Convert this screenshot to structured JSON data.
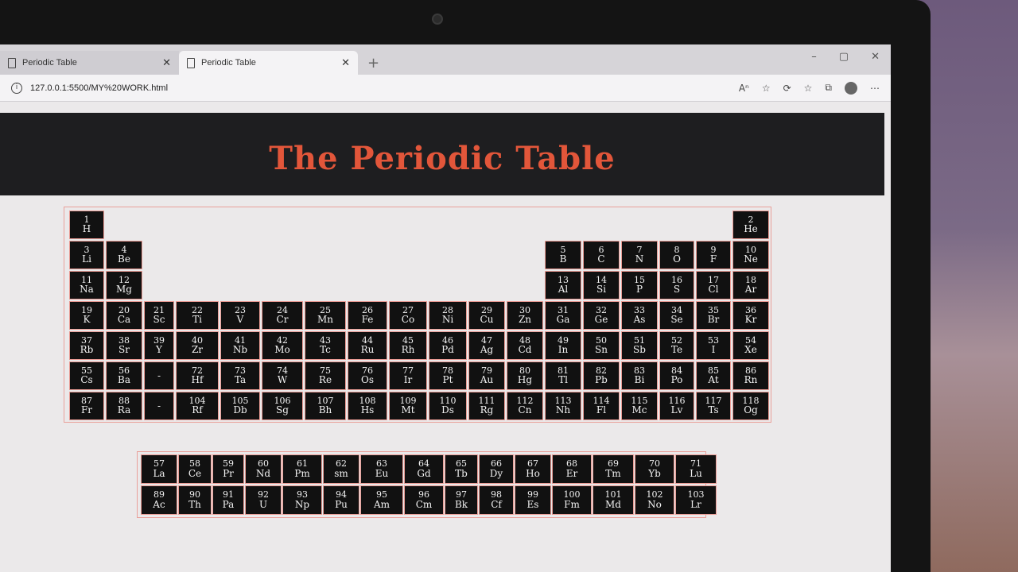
{
  "browser": {
    "tabs": [
      {
        "title": "Periodic Table",
        "active": false
      },
      {
        "title": "Periodic Table",
        "active": true
      }
    ],
    "url": "127.0.0.1:5500/MY%20WORK.html",
    "new_tab_symbol": "+",
    "close_symbol": "✕",
    "window_controls": [
      "–",
      "▢",
      "✕"
    ]
  },
  "page": {
    "title": "The Periodic Table"
  },
  "main_table": {
    "rows": [
      [
        {
          "n": "1",
          "s": "H",
          "c": 1
        },
        {
          "n": "2",
          "s": "He",
          "c": 18
        }
      ],
      [
        {
          "n": "3",
          "s": "Li",
          "c": 1
        },
        {
          "n": "4",
          "s": "Be",
          "c": 2
        },
        {
          "n": "5",
          "s": "B",
          "c": 13
        },
        {
          "n": "6",
          "s": "C",
          "c": 14
        },
        {
          "n": "7",
          "s": "N",
          "c": 15
        },
        {
          "n": "8",
          "s": "O",
          "c": 16
        },
        {
          "n": "9",
          "s": "F",
          "c": 17
        },
        {
          "n": "10",
          "s": "Ne",
          "c": 18
        }
      ],
      [
        {
          "n": "11",
          "s": "Na",
          "c": 1
        },
        {
          "n": "12",
          "s": "Mg",
          "c": 2
        },
        {
          "n": "13",
          "s": "Al",
          "c": 13
        },
        {
          "n": "14",
          "s": "Si",
          "c": 14
        },
        {
          "n": "15",
          "s": "P",
          "c": 15
        },
        {
          "n": "16",
          "s": "S",
          "c": 16
        },
        {
          "n": "17",
          "s": "Cl",
          "c": 17
        },
        {
          "n": "18",
          "s": "Ar",
          "c": 18
        }
      ],
      [
        {
          "n": "19",
          "s": "K",
          "c": 1
        },
        {
          "n": "20",
          "s": "Ca",
          "c": 2
        },
        {
          "n": "21",
          "s": "Sc",
          "c": 3
        },
        {
          "n": "22",
          "s": "Ti",
          "c": 4
        },
        {
          "n": "23",
          "s": "V",
          "c": 5
        },
        {
          "n": "24",
          "s": "Cr",
          "c": 6
        },
        {
          "n": "25",
          "s": "Mn",
          "c": 7
        },
        {
          "n": "26",
          "s": "Fe",
          "c": 8
        },
        {
          "n": "27",
          "s": "Co",
          "c": 9
        },
        {
          "n": "28",
          "s": "Ni",
          "c": 10
        },
        {
          "n": "29",
          "s": "Cu",
          "c": 11
        },
        {
          "n": "30",
          "s": "Zn",
          "c": 12
        },
        {
          "n": "31",
          "s": "Ga",
          "c": 13
        },
        {
          "n": "32",
          "s": "Ge",
          "c": 14
        },
        {
          "n": "33",
          "s": "As",
          "c": 15
        },
        {
          "n": "34",
          "s": "Se",
          "c": 16
        },
        {
          "n": "35",
          "s": "Br",
          "c": 17
        },
        {
          "n": "36",
          "s": "Kr",
          "c": 18
        }
      ],
      [
        {
          "n": "37",
          "s": "Rb",
          "c": 1
        },
        {
          "n": "38",
          "s": "Sr",
          "c": 2
        },
        {
          "n": "39",
          "s": "Y",
          "c": 3
        },
        {
          "n": "40",
          "s": "Zr",
          "c": 4
        },
        {
          "n": "41",
          "s": "Nb",
          "c": 5
        },
        {
          "n": "42",
          "s": "Mo",
          "c": 6
        },
        {
          "n": "43",
          "s": "Tc",
          "c": 7
        },
        {
          "n": "44",
          "s": "Ru",
          "c": 8
        },
        {
          "n": "45",
          "s": "Rh",
          "c": 9
        },
        {
          "n": "46",
          "s": "Pd",
          "c": 10
        },
        {
          "n": "47",
          "s": "Ag",
          "c": 11
        },
        {
          "n": "48",
          "s": "Cd",
          "c": 12
        },
        {
          "n": "49",
          "s": "In",
          "c": 13
        },
        {
          "n": "50",
          "s": "Sn",
          "c": 14
        },
        {
          "n": "51",
          "s": "Sb",
          "c": 15
        },
        {
          "n": "52",
          "s": "Te",
          "c": 16
        },
        {
          "n": "53",
          "s": "I",
          "c": 17
        },
        {
          "n": "54",
          "s": "Xe",
          "c": 18
        }
      ],
      [
        {
          "n": "55",
          "s": "Cs",
          "c": 1
        },
        {
          "n": "56",
          "s": "Ba",
          "c": 2
        },
        {
          "n": "",
          "s": "-",
          "c": 3
        },
        {
          "n": "72",
          "s": "Hf",
          "c": 4
        },
        {
          "n": "73",
          "s": "Ta",
          "c": 5
        },
        {
          "n": "74",
          "s": "W",
          "c": 6
        },
        {
          "n": "75",
          "s": "Re",
          "c": 7
        },
        {
          "n": "76",
          "s": "Os",
          "c": 8
        },
        {
          "n": "77",
          "s": "Ir",
          "c": 9
        },
        {
          "n": "78",
          "s": "Pt",
          "c": 10
        },
        {
          "n": "79",
          "s": "Au",
          "c": 11
        },
        {
          "n": "80",
          "s": "Hg",
          "c": 12
        },
        {
          "n": "81",
          "s": "Tl",
          "c": 13
        },
        {
          "n": "82",
          "s": "Pb",
          "c": 14
        },
        {
          "n": "83",
          "s": "Bi",
          "c": 15
        },
        {
          "n": "84",
          "s": "Po",
          "c": 16
        },
        {
          "n": "85",
          "s": "At",
          "c": 17
        },
        {
          "n": "86",
          "s": "Rn",
          "c": 18
        }
      ],
      [
        {
          "n": "87",
          "s": "Fr",
          "c": 1
        },
        {
          "n": "88",
          "s": "Ra",
          "c": 2
        },
        {
          "n": "",
          "s": "-",
          "c": 3
        },
        {
          "n": "104",
          "s": "Rf",
          "c": 4
        },
        {
          "n": "105",
          "s": "Db",
          "c": 5
        },
        {
          "n": "106",
          "s": "Sg",
          "c": 6
        },
        {
          "n": "107",
          "s": "Bh",
          "c": 7
        },
        {
          "n": "108",
          "s": "Hs",
          "c": 8
        },
        {
          "n": "109",
          "s": "Mt",
          "c": 9
        },
        {
          "n": "110",
          "s": "Ds",
          "c": 10
        },
        {
          "n": "111",
          "s": "Rg",
          "c": 11
        },
        {
          "n": "112",
          "s": "Cn",
          "c": 12
        },
        {
          "n": "113",
          "s": "Nh",
          "c": 13
        },
        {
          "n": "114",
          "s": "Fl",
          "c": 14
        },
        {
          "n": "115",
          "s": "Mc",
          "c": 15
        },
        {
          "n": "116",
          "s": "Lv",
          "c": 16
        },
        {
          "n": "117",
          "s": "Ts",
          "c": 17
        },
        {
          "n": "118",
          "s": "Og",
          "c": 18
        }
      ]
    ]
  },
  "f_block": {
    "rows": [
      [
        {
          "n": "57",
          "s": "La"
        },
        {
          "n": "58",
          "s": "Ce"
        },
        {
          "n": "59",
          "s": "Pr"
        },
        {
          "n": "60",
          "s": "Nd"
        },
        {
          "n": "61",
          "s": "Pm"
        },
        {
          "n": "62",
          "s": "sm"
        },
        {
          "n": "63",
          "s": "Eu"
        },
        {
          "n": "64",
          "s": "Gd"
        },
        {
          "n": "65",
          "s": "Tb"
        },
        {
          "n": "66",
          "s": "Dy"
        },
        {
          "n": "67",
          "s": "Ho"
        },
        {
          "n": "68",
          "s": "Er"
        },
        {
          "n": "69",
          "s": "Tm"
        },
        {
          "n": "70",
          "s": "Yb"
        },
        {
          "n": "71",
          "s": "Lu"
        }
      ],
      [
        {
          "n": "89",
          "s": "Ac"
        },
        {
          "n": "90",
          "s": "Th"
        },
        {
          "n": "91",
          "s": "Pa"
        },
        {
          "n": "92",
          "s": "U"
        },
        {
          "n": "93",
          "s": "Np"
        },
        {
          "n": "94",
          "s": "Pu"
        },
        {
          "n": "95",
          "s": "Am"
        },
        {
          "n": "96",
          "s": "Cm"
        },
        {
          "n": "97",
          "s": "Bk"
        },
        {
          "n": "98",
          "s": "Cf"
        },
        {
          "n": "99",
          "s": "Es"
        },
        {
          "n": "100",
          "s": "Fm"
        },
        {
          "n": "101",
          "s": "Md"
        },
        {
          "n": "102",
          "s": "No"
        },
        {
          "n": "103",
          "s": "Lr"
        }
      ]
    ]
  },
  "colors": {
    "header_bg": "#1e1e20",
    "title": "#e2563a",
    "cell_bg": "#111111",
    "cell_border": "#e99b94"
  }
}
